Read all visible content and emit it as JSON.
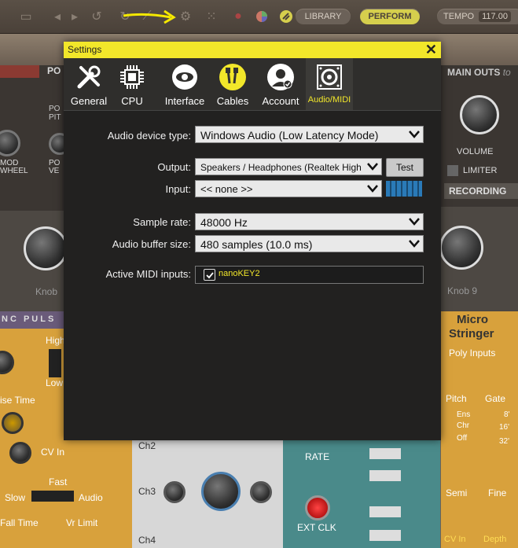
{
  "toolbar": {
    "library_label": "LIBRARY",
    "perform_label": "PERFORM",
    "tempo_label": "TEMPO",
    "tempo_value": "117.00"
  },
  "background": {
    "left_panel_label": "PO",
    "mod_label": "MOD",
    "wheel_label": "WHEEL",
    "pitch_label1": "PO",
    "pitch_label2": "PIT",
    "vel_label1": "PO",
    "vel_label2": "VE",
    "knob_left_label": "Knob",
    "pulse_title": "NC PULS",
    "high_label": "High",
    "low_label": "Low",
    "rise_label": "ise Time",
    "cv_in_label": "CV In",
    "fast_label": "Fast",
    "slow_label": "Slow",
    "audio_label": "Audio",
    "fall_label": "Fall Time",
    "vr_limit_label": "Vr Limit",
    "ch2_label": "Ch2",
    "ch3_label": "Ch3",
    "ch4_label": "Ch4",
    "rate_label": "RATE",
    "ext_clk_label": "EXT CLK",
    "main_outs_label": "MAIN OUTS",
    "main_outs_suffix": "to",
    "volume_label": "VOLUME",
    "limiter_label": "LIMITER",
    "recording_label": "RECORDING",
    "knob9_label": "Knob 9",
    "micro_label": "Micro",
    "stringer_label": "Stringer",
    "poly_inputs_label": "Poly Inputs",
    "pitch_label": "Pitch",
    "gate_label": "Gate",
    "ens_label": "Ens",
    "chr_label": "Chr",
    "off_label": "Off",
    "v8_label": "8'",
    "v16_label": "16'",
    "v32_label": "32'",
    "semi_label": "Semi",
    "fine_label": "Fine",
    "cv_in2_label": "CV In",
    "depth_label": "Depth"
  },
  "dialog": {
    "title": "Settings",
    "tabs": [
      {
        "label": "General",
        "icon": "tools-icon"
      },
      {
        "label": "CPU",
        "icon": "cpu-icon"
      },
      {
        "label": "Interface",
        "icon": "eye-icon"
      },
      {
        "label": "Cables",
        "icon": "cables-icon"
      },
      {
        "label": "Account",
        "icon": "account-icon"
      },
      {
        "label": "Audio/MIDI",
        "icon": "speaker-icon"
      }
    ],
    "active_tab": "Audio/MIDI",
    "audio_device_type_label": "Audio device type:",
    "audio_device_type_value": "Windows Audio (Low Latency Mode)",
    "output_label": "Output:",
    "output_value": "Speakers / Headphones (Realtek High Defi...",
    "test_label": "Test",
    "input_label": "Input:",
    "input_value": "<< none >>",
    "sample_rate_label": "Sample rate:",
    "sample_rate_value": "48000 Hz",
    "buffer_size_label": "Audio buffer size:",
    "buffer_size_value": "480 samples (10.0 ms)",
    "midi_inputs_label": "Active MIDI inputs:",
    "midi_inputs": [
      {
        "name": "nanoKEY2",
        "checked": true
      }
    ]
  },
  "colors": {
    "accent_yellow": "#f2e72a",
    "dialog_bg": "#222120",
    "toolbar_bg": "#4f463d",
    "perform_button": "#d6cf4d",
    "arrow_annotation": "#f5e900"
  }
}
